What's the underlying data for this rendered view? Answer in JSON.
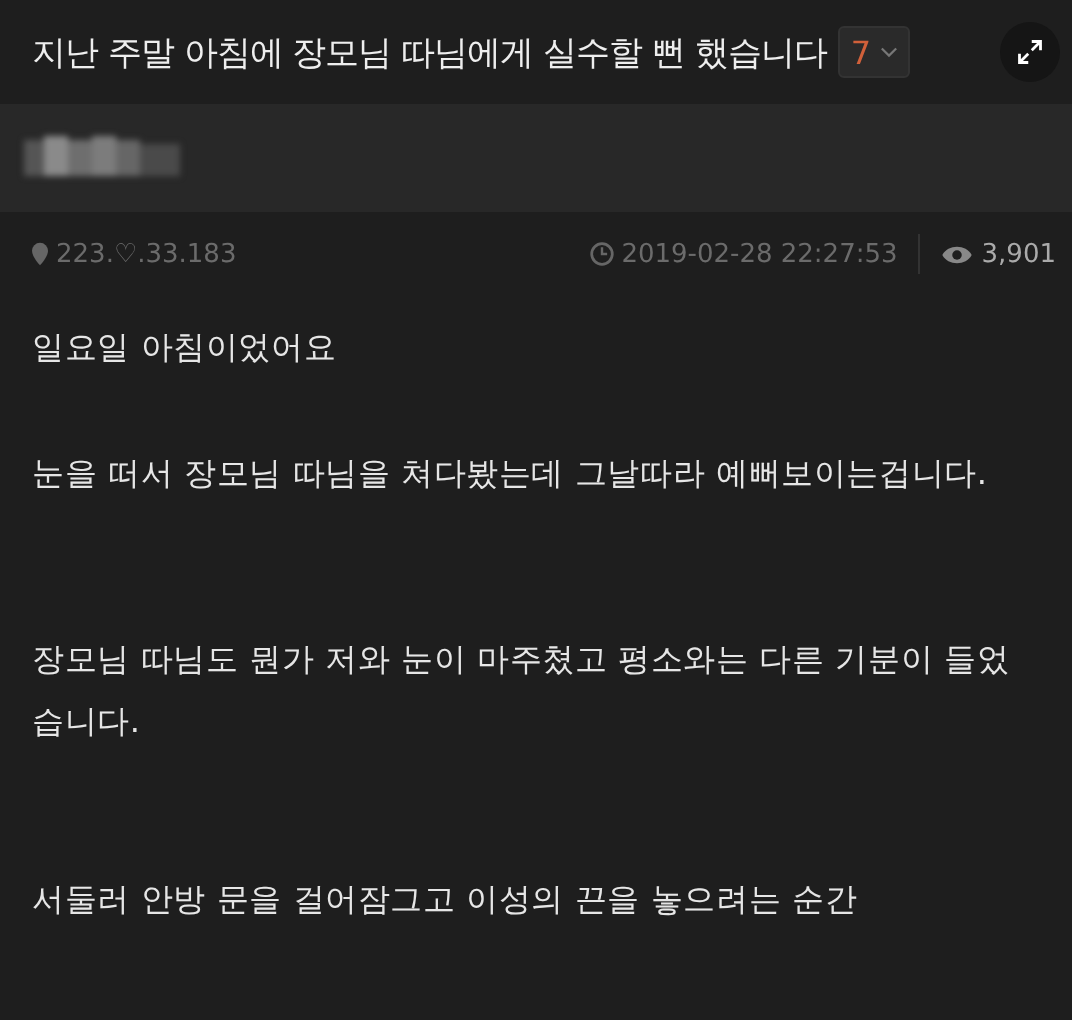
{
  "post": {
    "title": "지난 주말 아침에 장모님 따님에게 실수할 뻔 했습니다",
    "comment_count": "7",
    "ip": "223.♡.33.183",
    "datetime": "2019-02-28 22:27:53",
    "views": "3,901",
    "paragraphs": [
      "일요일 아침이었어요",
      "눈을 떠서 장모님 따님을 쳐다봤는데 그날따라 예뻐보이는겁니다.",
      "장모님 따님도 뭔가 저와 눈이 마주쳤고 평소와는 다른 기분이 들었습니다.",
      "서둘러 안방 문을 걸어잠그고 이성의 끈을 놓으려는 순간"
    ]
  }
}
